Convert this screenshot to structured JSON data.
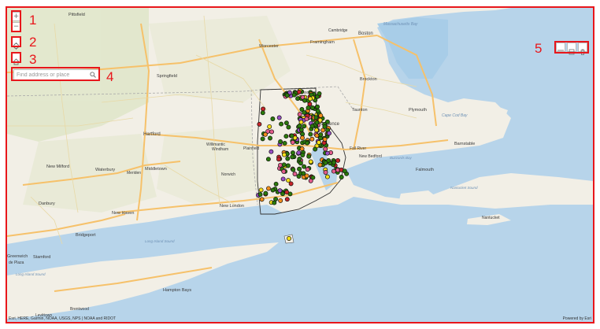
{
  "callouts": [
    "1",
    "2",
    "3",
    "4",
    "5"
  ],
  "controls": {
    "zoom_in": "+",
    "zoom_out": "−",
    "locate_icon": "crosshair-icon",
    "home_icon": "home-icon",
    "search_icon": "magnifier-icon",
    "layer_list_icon": "list-icon",
    "basemap_icon": "grid-icon",
    "delete_icon": "trash-icon"
  },
  "search": {
    "placeholder": "Find address or place"
  },
  "attribution": {
    "left": "Esri, HERE, Garmin, NOAA, USGS, NPS | NOAA and RIDOT",
    "right": "Powered by Esri"
  },
  "places": {
    "pittsfield": "Pittsfield",
    "worcester": "Worcester",
    "framingham": "Framingham",
    "cambridge": "Cambridge",
    "boston": "Boston",
    "massachusetts_bay": "Massachusetts Bay",
    "springfield": "Springfield",
    "brockton": "Brockton",
    "woonsocket": "Woonsocket",
    "taunton": "Taunton",
    "plymouth": "Plymouth",
    "cape_cod_bay": "Cape Cod Bay",
    "hartford": "Hartford",
    "providence": "Providence",
    "willimantic": "Willimantic",
    "windham": "Windham",
    "plainfield": "Plainfield",
    "fall_river": "Fall River",
    "barnstable": "Barnstable",
    "new_milford": "New Milford",
    "waterbury": "Waterbury",
    "meriden": "Meriden",
    "middletown": "Middletown",
    "norwich": "Norwich",
    "new_bedford": "New Bedford",
    "buzzards_bay": "Buzzards Bay",
    "falmouth": "Falmouth",
    "nantucket_sound": "Nantucket Sound",
    "danbury": "Danbury",
    "new_london": "New London",
    "new_haven": "New Haven",
    "nantucket": "Nantucket",
    "bridgeport": "Bridgeport",
    "long_island_sound": "Long Island Sound",
    "greenwich": "Greenwich",
    "stamford": "Stamford",
    "de_plaza": "de Plaza",
    "long_island_sound_2": "Long Island Sound",
    "hampton_bays": "Hampton Bays",
    "levittown": "Levittown",
    "brentwood": "Brentwood"
  },
  "colors": {
    "frame": "#e8161b",
    "land": "#f2efe6",
    "water": "#b7d4ea",
    "ocean": "#a8cde8",
    "forest": "#dce4c7",
    "road": "#f6c16a",
    "point_green": "#2b7a0b",
    "point_orange": "#f28e1c",
    "point_yellow": "#f4e01a",
    "point_pink": "#e45c8c",
    "point_purple": "#9a4fc7",
    "point_red": "#c7242a"
  }
}
